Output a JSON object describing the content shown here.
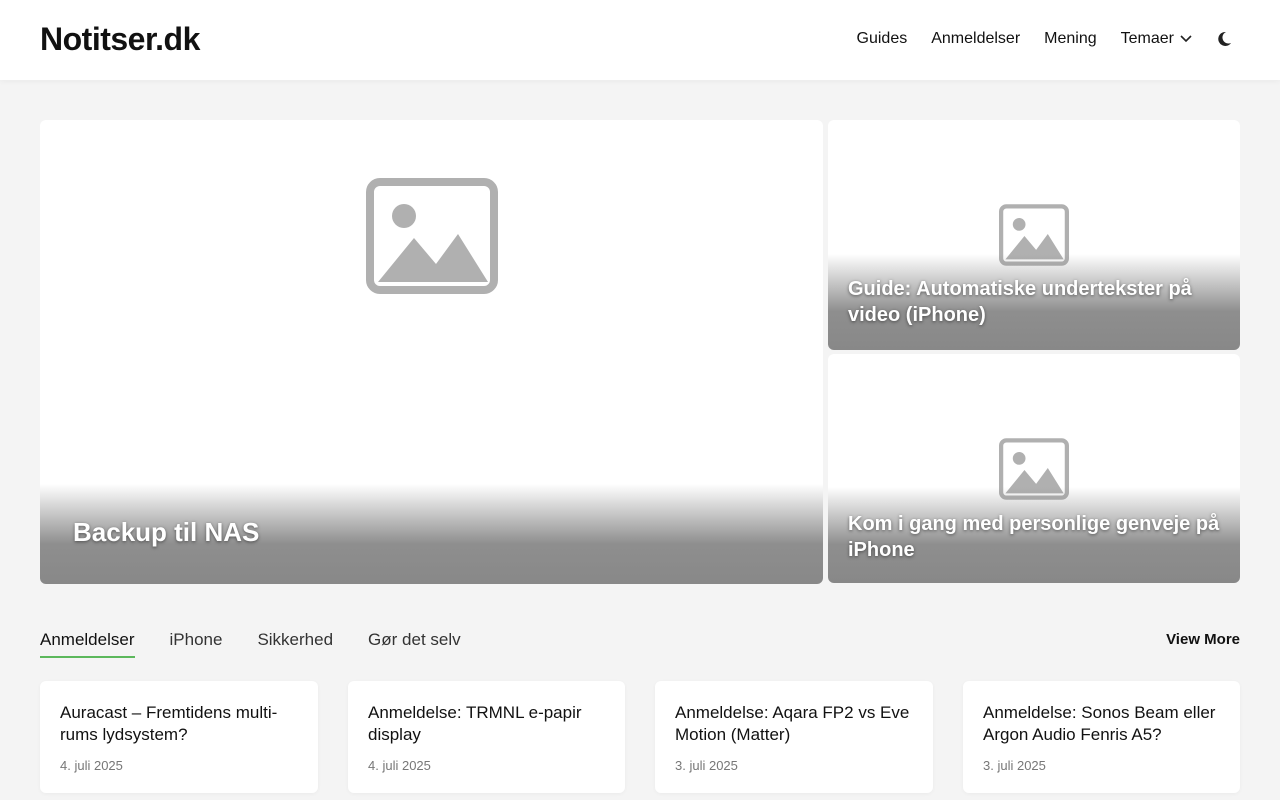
{
  "header": {
    "logo": "Notitser.dk",
    "nav": [
      "Guides",
      "Anmeldelser",
      "Mening",
      "Temaer"
    ]
  },
  "hero": {
    "main": "Backup til NAS",
    "side": [
      "Guide: Automatiske undertekster på video (iPhone)",
      "Kom i gang med personlige genveje på iPhone"
    ]
  },
  "tabs": [
    "Anmeldelser",
    "iPhone",
    "Sikkerhed",
    "Gør det selv"
  ],
  "view_more": "View More",
  "posts": [
    {
      "title": "Auracast – Fremtidens multi-rums lydsystem?",
      "date": "4. juli 2025"
    },
    {
      "title": "Anmeldelse: TRMNL e-papir display",
      "date": "4. juli 2025"
    },
    {
      "title": "Anmeldelse: Aqara FP2 vs Eve Motion (Matter)",
      "date": "3. juli 2025"
    },
    {
      "title": "Anmeldelse: Sonos Beam eller Argon Audio Fenris A5?",
      "date": "3. juli 2025"
    }
  ]
}
